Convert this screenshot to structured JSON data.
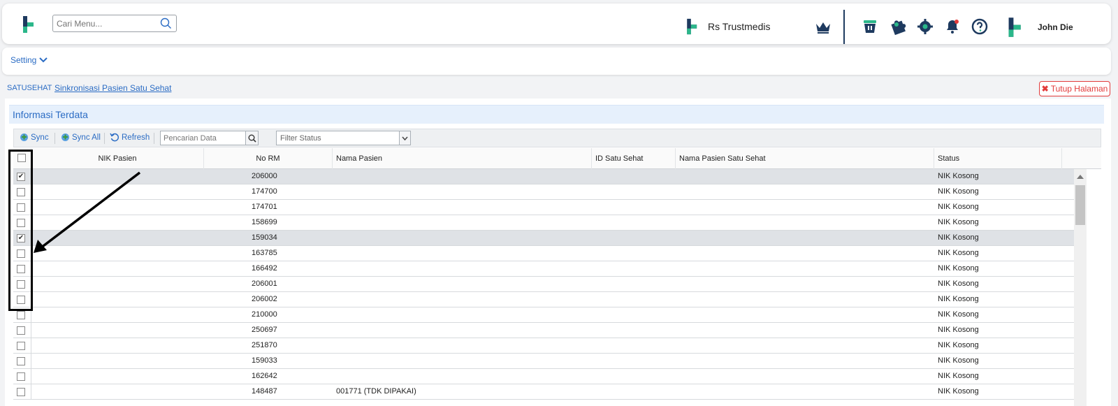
{
  "header": {
    "search_placeholder": "Cari Menu...",
    "hospital_name": "Rs Trustmedis",
    "user_name": "John Die",
    "icons": [
      "crown-icon",
      "basket-icon",
      "puzzle-icon",
      "gear-icon",
      "bell-icon",
      "help-icon"
    ]
  },
  "setting_menu": {
    "label": "Setting"
  },
  "breadcrumb": {
    "root": "SATUSEHAT",
    "page": "Sinkronisasi Pasien Satu Sehat"
  },
  "close_button": {
    "label": "Tutup Halaman"
  },
  "panel": {
    "title": "Informasi Terdata"
  },
  "toolbar": {
    "sync_label": "Sync",
    "sync_all_label": "Sync All",
    "refresh_label": "Refresh",
    "search_placeholder": "Pencarian Data",
    "filter_placeholder": "Filter Status"
  },
  "table": {
    "columns": [
      "NIK Pasien",
      "No RM",
      "Nama Pasien",
      "ID Satu Sehat",
      "Nama Pasien Satu Sehat",
      "Status"
    ],
    "rows": [
      {
        "checked": true,
        "nik": "",
        "no_rm": "206000",
        "nama": "",
        "id_ss": "",
        "nama_ss": "",
        "status": "NIK Kosong"
      },
      {
        "checked": false,
        "nik": "",
        "no_rm": "174700",
        "nama": "",
        "id_ss": "",
        "nama_ss": "",
        "status": "NIK Kosong"
      },
      {
        "checked": false,
        "nik": "",
        "no_rm": "174701",
        "nama": "",
        "id_ss": "",
        "nama_ss": "",
        "status": "NIK Kosong"
      },
      {
        "checked": false,
        "nik": "",
        "no_rm": "158699",
        "nama": "",
        "id_ss": "",
        "nama_ss": "",
        "status": "NIK Kosong"
      },
      {
        "checked": true,
        "nik": "",
        "no_rm": "159034",
        "nama": "",
        "id_ss": "",
        "nama_ss": "",
        "status": "NIK Kosong"
      },
      {
        "checked": false,
        "nik": "",
        "no_rm": "163785",
        "nama": "",
        "id_ss": "",
        "nama_ss": "",
        "status": "NIK Kosong"
      },
      {
        "checked": false,
        "nik": "",
        "no_rm": "166492",
        "nama": "",
        "id_ss": "",
        "nama_ss": "",
        "status": "NIK Kosong"
      },
      {
        "checked": false,
        "nik": "",
        "no_rm": "206001",
        "nama": "",
        "id_ss": "",
        "nama_ss": "",
        "status": "NIK Kosong"
      },
      {
        "checked": false,
        "nik": "",
        "no_rm": "206002",
        "nama": "",
        "id_ss": "",
        "nama_ss": "",
        "status": "NIK Kosong"
      },
      {
        "checked": false,
        "nik": "",
        "no_rm": "210000",
        "nama": "",
        "id_ss": "",
        "nama_ss": "",
        "status": "NIK Kosong"
      },
      {
        "checked": false,
        "nik": "",
        "no_rm": "250697",
        "nama": "",
        "id_ss": "",
        "nama_ss": "",
        "status": "NIK Kosong"
      },
      {
        "checked": false,
        "nik": "",
        "no_rm": "251870",
        "nama": "",
        "id_ss": "",
        "nama_ss": "",
        "status": "NIK Kosong"
      },
      {
        "checked": false,
        "nik": "",
        "no_rm": "159033",
        "nama": "",
        "id_ss": "",
        "nama_ss": "",
        "status": "NIK Kosong"
      },
      {
        "checked": false,
        "nik": "",
        "no_rm": "162642",
        "nama": "",
        "id_ss": "",
        "nama_ss": "",
        "status": "NIK Kosong"
      },
      {
        "checked": false,
        "nik": "",
        "no_rm": "148487",
        "nama": "001771 (TDK DIPAKAI)",
        "id_ss": "",
        "nama_ss": "",
        "status": "NIK Kosong"
      }
    ]
  },
  "colors": {
    "accent": "#2b6cc4",
    "logo_teal": "#2bb78a",
    "logo_navy": "#1e3a5f",
    "danger": "#e23b3b"
  }
}
